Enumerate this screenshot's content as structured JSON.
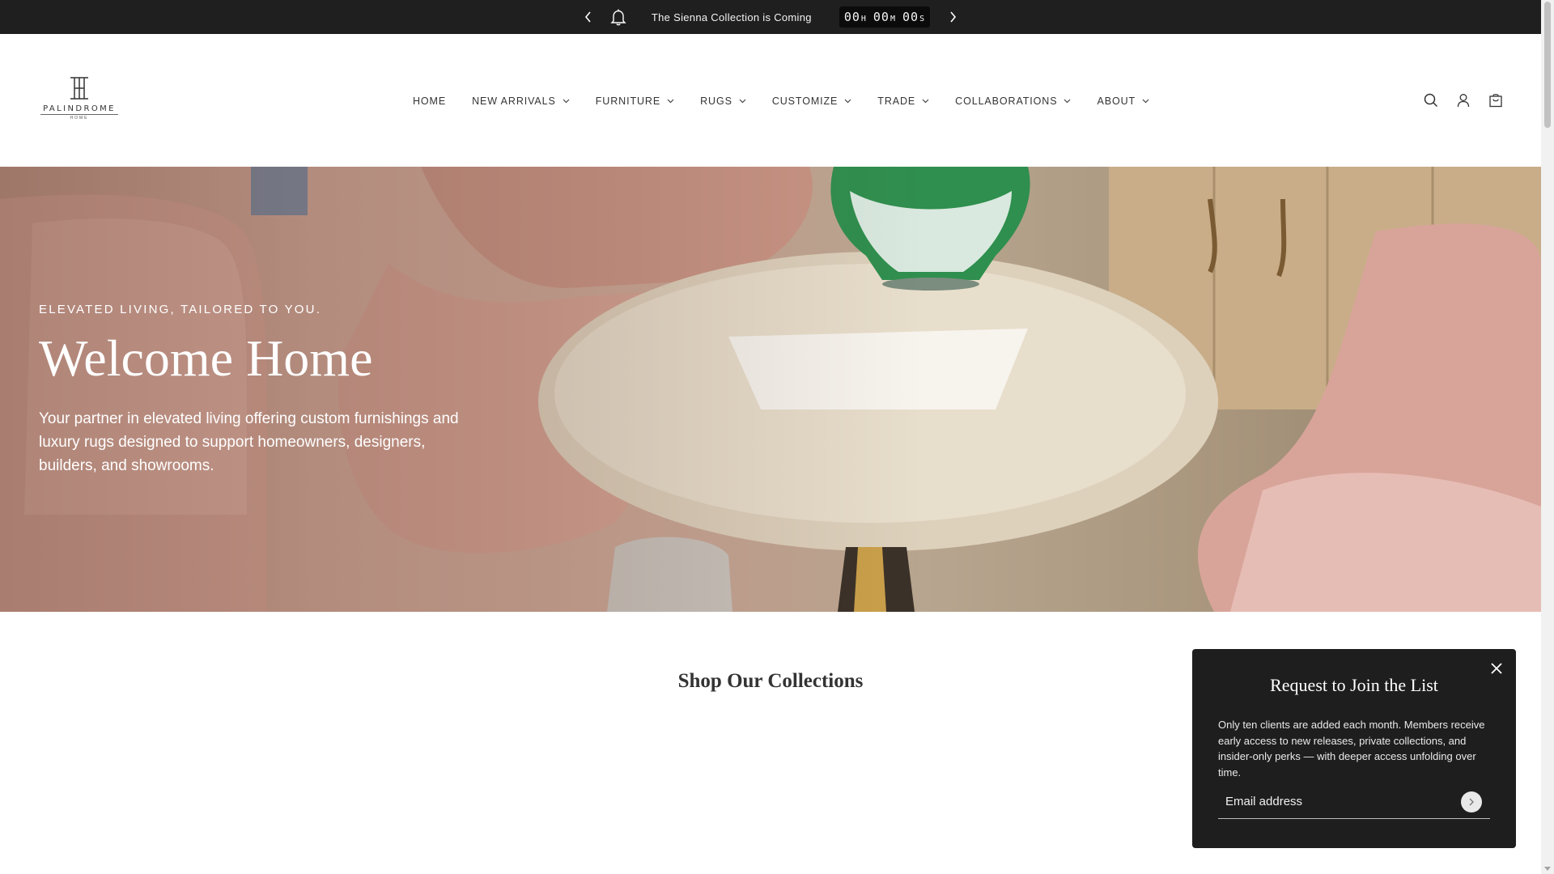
{
  "announcement": {
    "message": "The Sienna Collection is Coming",
    "countdown": {
      "hours": "00",
      "h_unit": "H",
      "minutes": "00",
      "m_unit": "M",
      "seconds": "00",
      "s_unit": "S"
    }
  },
  "logo": {
    "wordmark": "PALINDROME",
    "subline": "HOME"
  },
  "nav": {
    "items": [
      {
        "label": "HOME",
        "has_dropdown": false
      },
      {
        "label": "NEW ARRIVALS",
        "has_dropdown": true
      },
      {
        "label": "FURNITURE",
        "has_dropdown": true
      },
      {
        "label": "RUGS",
        "has_dropdown": true
      },
      {
        "label": "CUSTOMIZE",
        "has_dropdown": true
      },
      {
        "label": "TRADE",
        "has_dropdown": true
      },
      {
        "label": "COLLABORATIONS",
        "has_dropdown": true
      },
      {
        "label": "ABOUT",
        "has_dropdown": true
      }
    ]
  },
  "header_icons": [
    "search-icon",
    "account-icon",
    "cart-icon"
  ],
  "hero": {
    "eyebrow": "ELEVATED LIVING, TAILORED TO YOU.",
    "title": "Welcome Home",
    "subtitle": "Your partner in elevated living offering custom furnishings and luxury rugs designed to support homeowners, designers, builders, and showrooms."
  },
  "collections": {
    "title": "Shop Our Collections"
  },
  "popup": {
    "title": "Request to Join the List",
    "body": "Only ten clients are added each month. Members receive early access to new releases, private collections, and insider-only perks — with deeper access unfolding over time.",
    "email_placeholder": "Email address"
  },
  "colors": {
    "announcement_bg": "#1f1f1f",
    "popup_bg": "#1e1e1e",
    "hero_tone": "#d3aa9a"
  }
}
